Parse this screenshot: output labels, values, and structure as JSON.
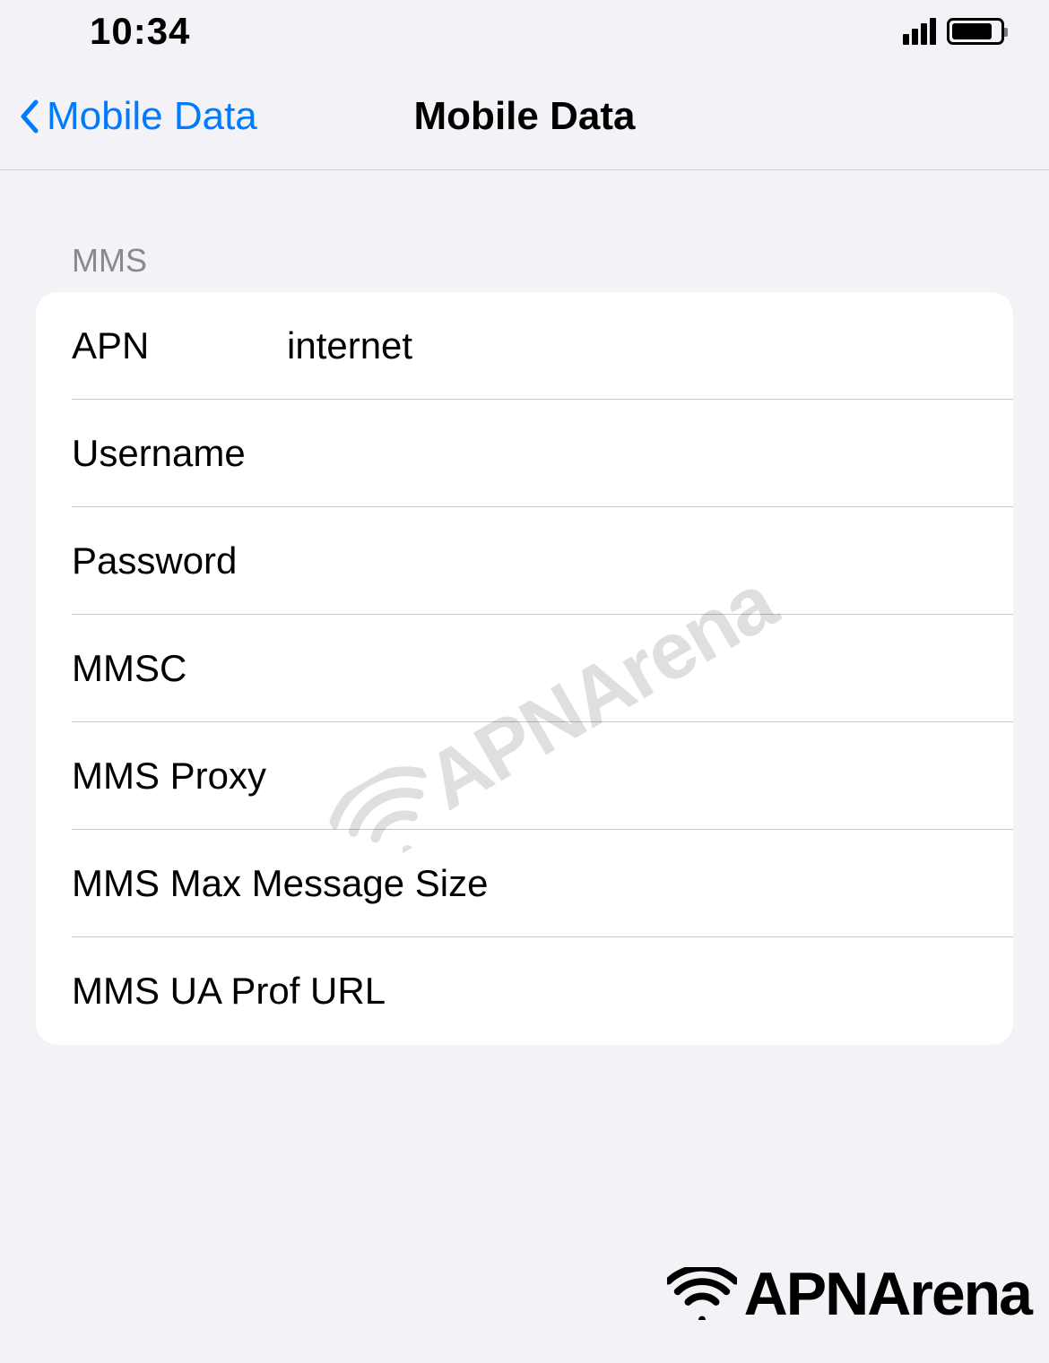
{
  "status_bar": {
    "time": "10:34"
  },
  "nav": {
    "back_label": "Mobile Data",
    "title": "Mobile Data"
  },
  "section": {
    "header": "MMS",
    "rows": [
      {
        "label": "APN",
        "value": "internet"
      },
      {
        "label": "Username",
        "value": ""
      },
      {
        "label": "Password",
        "value": ""
      },
      {
        "label": "MMSC",
        "value": ""
      },
      {
        "label": "MMS Proxy",
        "value": ""
      },
      {
        "label": "MMS Max Message Size",
        "value": ""
      },
      {
        "label": "MMS UA Prof URL",
        "value": ""
      }
    ]
  },
  "brand": {
    "name": "APNArena"
  }
}
